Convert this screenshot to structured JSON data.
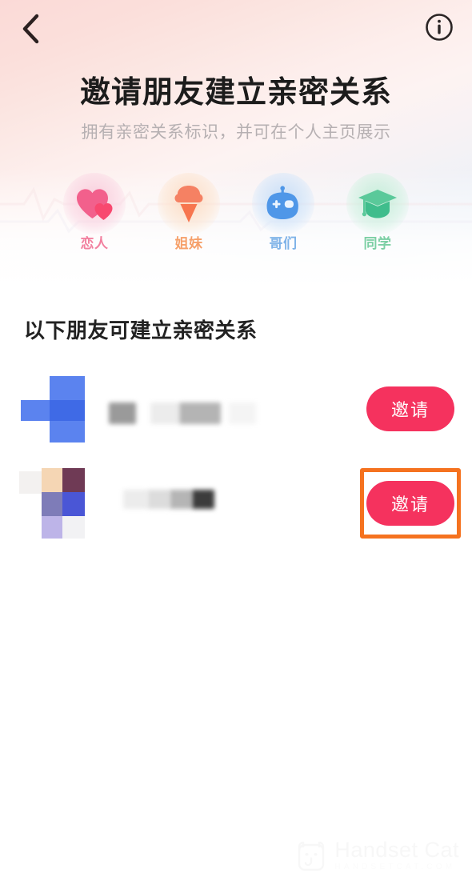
{
  "topbar": {
    "back_icon": "chevron-left-icon",
    "info_icon": "info-circle-icon"
  },
  "header": {
    "title": "邀请朋友建立亲密关系",
    "subtitle": "拥有亲密关系标识，并可在个人主页展示"
  },
  "relationship_types": [
    {
      "label": "恋人",
      "icon": "double-heart-icon",
      "color": "#f2809f"
    },
    {
      "label": "姐妹",
      "icon": "ice-cream-cone-icon",
      "color": "#f6a06a"
    },
    {
      "label": "哥们",
      "icon": "game-controller-icon",
      "color": "#7fb3e8"
    },
    {
      "label": "同学",
      "icon": "graduation-cap-icon",
      "color": "#7ccfa4"
    }
  ],
  "friend_section": {
    "heading": "以下朋友可建立亲密关系",
    "rows": [
      {
        "name": "",
        "invite_label": "邀请",
        "highlighted": false
      },
      {
        "name": "",
        "invite_label": "邀请",
        "highlighted": true
      }
    ]
  },
  "colors": {
    "invite_button": "#f5325e",
    "highlight_border": "#f5721f",
    "title": "#1c1c1c",
    "subtitle": "#b6b0b2"
  },
  "watermark": {
    "name": "Handset Cat",
    "domain": "HANDSETCAT.COM",
    "icon": "cat-face-icon"
  }
}
